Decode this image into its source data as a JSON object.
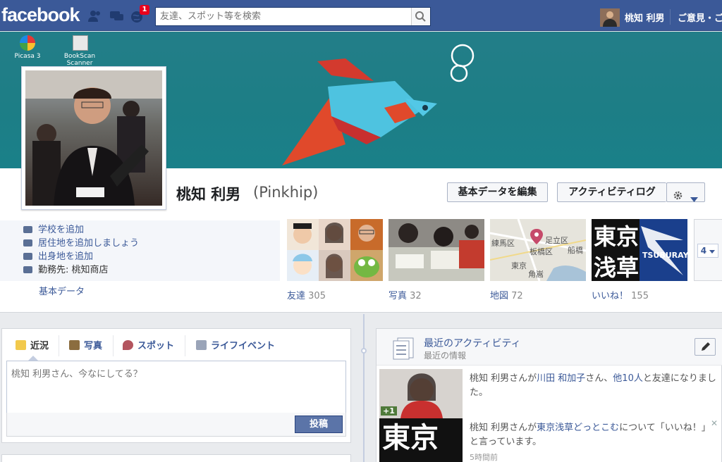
{
  "topbar": {
    "logo": "facebook",
    "notification_count": "1",
    "search_placeholder": "友達、スポット等を検索",
    "user_name": "桃知 利男",
    "help_link": "ご意見・ご"
  },
  "desktop_icons": [
    {
      "label": "Picasa 3"
    },
    {
      "label": "BookScan Scanner"
    }
  ],
  "profile": {
    "name": "桃知 利男",
    "alternate_name": "(Pinkhip)",
    "edit_button": "基本データを編集",
    "activity_log_button": "アクティビティログ"
  },
  "about": {
    "items": [
      {
        "text": "学校を追加"
      },
      {
        "text": "居住地を追加しましょう"
      },
      {
        "text": "出身地を追加"
      },
      {
        "text": "勤務先: 桃知商店"
      }
    ],
    "label": "基本データ"
  },
  "tiles": [
    {
      "label": "友達",
      "count": "305"
    },
    {
      "label": "写真",
      "count": "32"
    },
    {
      "label": "地図",
      "count": "72"
    },
    {
      "label": "いいね！",
      "count": "155"
    }
  ],
  "map_labels": [
    "足立区",
    "練馬区",
    "板橋区",
    "船橋",
    "東京",
    "角嵩"
  ],
  "likes_tile": {
    "text1": "東京",
    "text2": "浅草",
    "logo": "TSUBURAYA"
  },
  "more_count": "4",
  "composer": {
    "tabs": [
      "近況",
      "写真",
      "スポット",
      "ライフイベント"
    ],
    "placeholder": "桃知 利男さん、今なにしてる？",
    "post_button": "投稿"
  },
  "activity": {
    "title": "最近のアクティビティ",
    "subtitle": "最近の情報",
    "items": [
      {
        "before": "桃知 利男さんが",
        "link1": "川田 和加子",
        "mid": "さん、",
        "link2": "他10人",
        "after": "と友達になりました。"
      },
      {
        "before": "桃知 利男さんが",
        "link1": "東京浅草どっとこむ",
        "after": "について「いいね！」と言っています。"
      }
    ],
    "time": "5時間前",
    "thumb_badge": "+1",
    "thumb_text": "東京"
  },
  "colors": {
    "brand": "#3b5998",
    "cover": "#1f7e87"
  }
}
